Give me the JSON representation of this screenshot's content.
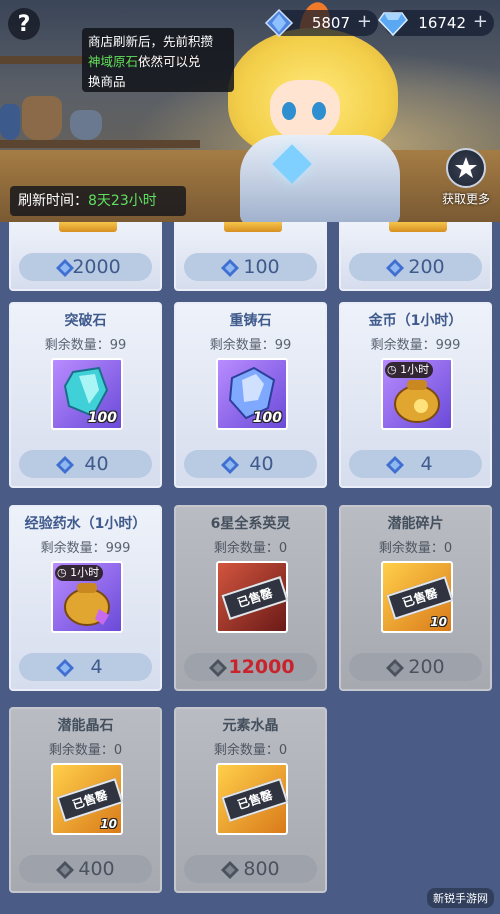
{
  "currency": {
    "crystal_amount": "5807",
    "diamond_amount": "16742",
    "add_symbol": "+"
  },
  "help": {
    "symbol": "?"
  },
  "tip_bubble": {
    "line1": "商店刷新后，先前积攒",
    "line2_highlight": "神域原石",
    "line2_rest": "依然可以兑",
    "line3": "换商品"
  },
  "refresh": {
    "label": "刷新时间：",
    "value": "8天23小时"
  },
  "more_button": {
    "label": "获取更多"
  },
  "colors": {
    "crystal_blue": "#3f6fd0",
    "highlight_green": "#5fe05f",
    "sold_price_red": "#c9232c"
  },
  "top_row_prices": [
    "2000",
    "100",
    "200"
  ],
  "items": [
    {
      "name": "突破石",
      "remain": "剩余数量：99",
      "qty": "100",
      "price": "40",
      "timer": "",
      "sold_out": false,
      "icon": "breakthrough-stone-icon"
    },
    {
      "name": "重铸石",
      "remain": "剩余数量：99",
      "qty": "100",
      "price": "40",
      "timer": "",
      "sold_out": false,
      "icon": "reforge-stone-icon"
    },
    {
      "name": "金币（1小时）",
      "remain": "剩余数量：999",
      "qty": "",
      "price": "4",
      "timer": "1小时",
      "sold_out": false,
      "icon": "gold-bag-icon"
    },
    {
      "name": "经验药水（1小时）",
      "remain": "剩余数量：999",
      "qty": "",
      "price": "4",
      "timer": "1小时",
      "sold_out": false,
      "icon": "exp-potion-bag-icon"
    },
    {
      "name": "6星全系英灵",
      "remain": "剩余数量：0",
      "qty": "",
      "price": "12000",
      "timer": "",
      "sold_out": true,
      "icon": "hero-spirit-icon"
    },
    {
      "name": "潜能碎片",
      "remain": "剩余数量：0",
      "qty": "10",
      "price": "200",
      "timer": "",
      "sold_out": true,
      "icon": "potential-shard-icon"
    },
    {
      "name": "潜能晶石",
      "remain": "剩余数量：0",
      "qty": "10",
      "price": "400",
      "timer": "",
      "sold_out": true,
      "icon": "potential-crystal-icon"
    },
    {
      "name": "元素水晶",
      "remain": "剩余数量：0",
      "qty": "",
      "price": "800",
      "timer": "",
      "sold_out": true,
      "icon": "element-crystal-icon"
    }
  ],
  "sold_out_label": "已售罄",
  "watermark": "新锐手游网"
}
